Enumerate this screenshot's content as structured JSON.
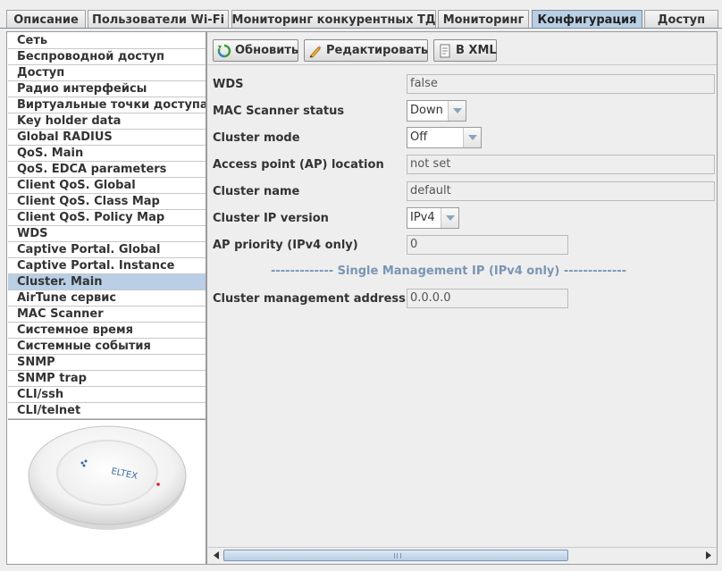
{
  "tabs": [
    {
      "label": "Описание",
      "active": false
    },
    {
      "label": "Пользователи Wi-Fi",
      "active": false
    },
    {
      "label": "Мониторинг конкурентных ТД",
      "active": false
    },
    {
      "label": "Мониторинг",
      "active": false
    },
    {
      "label": "Конфигурация",
      "active": true
    },
    {
      "label": "Доступ",
      "active": false
    }
  ],
  "sidebar": {
    "items": [
      {
        "label": "Сеть"
      },
      {
        "label": "Беспроводной доступ"
      },
      {
        "label": "Доступ"
      },
      {
        "label": "Радио интерфейсы"
      },
      {
        "label": "Виртуальные точки доступа"
      },
      {
        "label": "Key holder data"
      },
      {
        "label": "Global RADIUS"
      },
      {
        "label": "QoS. Main"
      },
      {
        "label": "QoS. EDCA parameters"
      },
      {
        "label": "Client QoS. Global"
      },
      {
        "label": "Client QoS. Class Map"
      },
      {
        "label": "Client QoS. Policy Map"
      },
      {
        "label": "WDS"
      },
      {
        "label": "Captive Portal. Global"
      },
      {
        "label": "Captive Portal. Instance"
      },
      {
        "label": "Cluster. Main",
        "selected": true
      },
      {
        "label": "AirTune сервис"
      },
      {
        "label": "MAC Scanner"
      },
      {
        "label": "Системное время"
      },
      {
        "label": "Системные события"
      },
      {
        "label": "SNMP"
      },
      {
        "label": "SNMP trap"
      },
      {
        "label": "CLI/ssh"
      },
      {
        "label": "CLI/telnet"
      }
    ],
    "device_logo": "ELTEX"
  },
  "toolbar": {
    "refresh_label": "Обновить",
    "edit_label": "Редактировать",
    "xml_label": "В XML"
  },
  "form": {
    "wds": {
      "label": "WDS",
      "value": "false"
    },
    "mac_scanner": {
      "label": "MAC Scanner status",
      "value": "Down"
    },
    "cluster_mode": {
      "label": "Cluster mode",
      "value": "Off"
    },
    "ap_location": {
      "label": "Access point (AP) location",
      "value": "not set"
    },
    "cluster_name": {
      "label": "Cluster name",
      "value": "default"
    },
    "cluster_ip_version": {
      "label": "Cluster IP version",
      "value": "IPv4"
    },
    "ap_priority": {
      "label": "AP priority (IPv4 only)",
      "value": "0"
    },
    "section_title": "------------- Single Management IP (IPv4 only) -------------",
    "cluster_mgmt_address": {
      "label": "Cluster management address",
      "value": "0.0.0.0"
    }
  },
  "colors": {
    "selection": "#b8cfe5",
    "section_title": "#7a95b4",
    "background": "#eeeeee"
  },
  "icons": {
    "refresh": "refresh-icon",
    "edit": "pencil-icon",
    "xml": "document-icon"
  }
}
